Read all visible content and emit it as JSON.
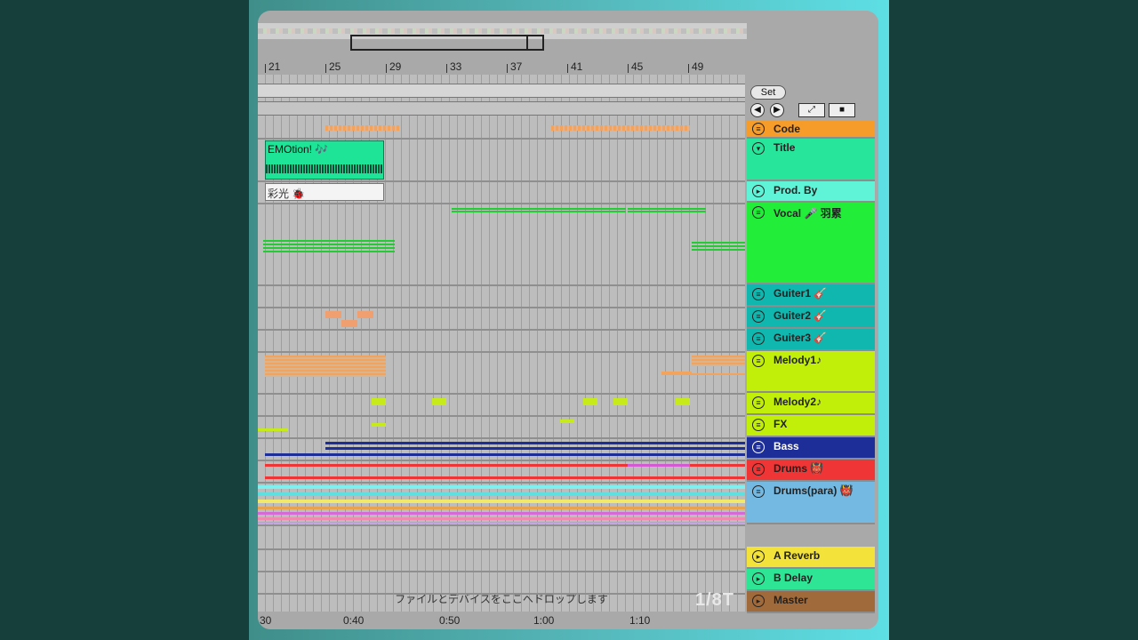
{
  "ruler": {
    "bars": [
      "21",
      "25",
      "29",
      "33",
      "37",
      "41",
      "45",
      "49"
    ]
  },
  "set_button": {
    "label": "Set"
  },
  "nav": {
    "prev_icon": "arrow-left-icon",
    "next_icon": "arrow-right-icon",
    "expand_icon": "expand-icon",
    "lock_icon": "lock-icon"
  },
  "tracks": [
    {
      "name": "Code",
      "color": "#f59c2b"
    },
    {
      "name": "Title",
      "color": "#27e59b"
    },
    {
      "name": "Prod. By",
      "color": "#5ff3d8"
    },
    {
      "name": "Vocal 🎤 羽累",
      "color": "#22ee3a"
    },
    {
      "name": "Guiter1 🎸",
      "color": "#10b7ae"
    },
    {
      "name": "Guiter2 🎸",
      "color": "#10b7ae"
    },
    {
      "name": "Guiter3 🎸",
      "color": "#10b7ae"
    },
    {
      "name": "Melody1♪",
      "color": "#c2ef0a"
    },
    {
      "name": "Melody2♪",
      "color": "#c2ef0a"
    },
    {
      "name": "FX",
      "color": "#c2ef0a"
    },
    {
      "name": "Bass",
      "color": "#1d2e98"
    },
    {
      "name": "Drums 👹",
      "color": "#ef3535"
    },
    {
      "name": "Drums(para) 👹",
      "color": "#74b9e2"
    }
  ],
  "returns": [
    {
      "name": "A Reverb",
      "color": "#f2e23a"
    },
    {
      "name": "B Delay",
      "color": "#2de595"
    },
    {
      "name": "Master",
      "color": "#a16a3a"
    }
  ],
  "clips": {
    "title_clip": "EMOtion! 🎶",
    "prod_clip": "彩光 🐞"
  },
  "drop_text": "ファイルとデバイスをここへドロップします",
  "quantize": "1/8T",
  "timeline": [
    "30",
    "0:40",
    "0:50",
    "1:00",
    "1:10"
  ]
}
